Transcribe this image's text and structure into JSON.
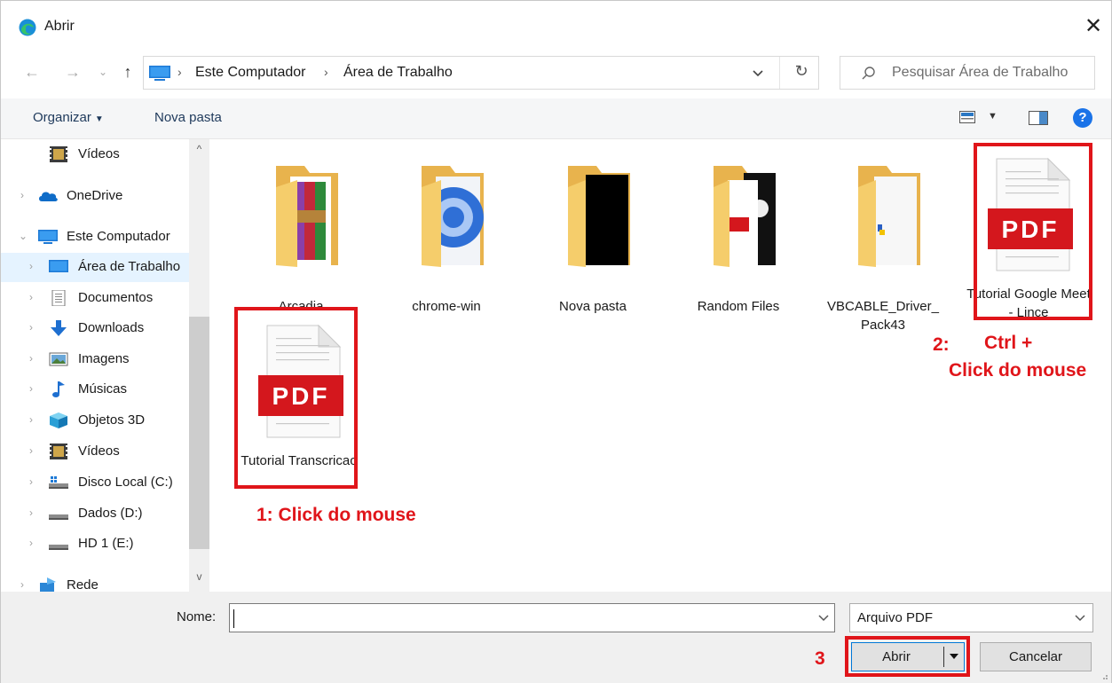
{
  "window": {
    "title": "Abrir",
    "close_glyph": "✕"
  },
  "nav": {
    "back_glyph": "←",
    "forward_glyph": "→",
    "recent_glyph": "⌄",
    "up_glyph": "↑",
    "breadcrumbs": [
      "Este Computador",
      "Área de Trabalho"
    ],
    "crumb_separator": "›",
    "refresh_glyph": "↻"
  },
  "search": {
    "placeholder": "Pesquisar Área de Trabalho"
  },
  "toolbar": {
    "organize_label": "Organizar",
    "organize_caret": "▼",
    "new_folder_label": "Nova pasta",
    "view_caret": "▼",
    "help_glyph": "?"
  },
  "sidebar": {
    "scroll_up": "^",
    "scroll_down": "v",
    "chevron_right": "›",
    "chevron_down": "⌄",
    "items": [
      {
        "label": "Vídeos",
        "icon": "video-icon"
      },
      {
        "label": "OneDrive",
        "icon": "cloud-icon"
      },
      {
        "label": "Este Computador",
        "icon": "computer-icon"
      },
      {
        "label": "Área de Trabalho",
        "icon": "desktop-icon"
      },
      {
        "label": "Documentos",
        "icon": "document-icon"
      },
      {
        "label": "Downloads",
        "icon": "download-arrow-icon"
      },
      {
        "label": "Imagens",
        "icon": "picture-icon"
      },
      {
        "label": "Músicas",
        "icon": "music-note-icon"
      },
      {
        "label": "Objetos 3D",
        "icon": "cube-3d-icon"
      },
      {
        "label": "Vídeos",
        "icon": "video-icon"
      },
      {
        "label": "Disco Local (C:)",
        "icon": "drive-icon"
      },
      {
        "label": "Dados (D:)",
        "icon": "drive-icon"
      },
      {
        "label": "HD 1 (E:)",
        "icon": "drive-icon"
      },
      {
        "label": "Rede",
        "icon": "network-icon"
      }
    ]
  },
  "files": [
    {
      "name": "Arcadia",
      "type": "folder",
      "thumb": "winrar-books-icon"
    },
    {
      "name": "chrome-win",
      "type": "folder",
      "thumb": "chrome-disc-icon"
    },
    {
      "name": "Nova pasta",
      "type": "folder",
      "thumb": "black-document-icon"
    },
    {
      "name": "Random Files",
      "type": "folder",
      "thumb": "pdf-document-icon"
    },
    {
      "name": "VBCABLE_Driver_ Pack43",
      "type": "folder",
      "thumb": "setup-document-icon"
    },
    {
      "name": "Tutorial Google Meet - Lince",
      "type": "pdf",
      "thumb": "pdf-file-icon"
    },
    {
      "name": "Tutorial Transcricao",
      "type": "pdf",
      "thumb": "pdf-file-icon"
    }
  ],
  "pdf_badge": "PDF",
  "annotations": {
    "step1": "1: Click do mouse",
    "step2_num": "2:",
    "step2_line1": "Ctrl +",
    "step2_line2": "Click do mouse",
    "step3": "3"
  },
  "bottom": {
    "name_label": "Nome:",
    "name_value": "",
    "filetype_value": "Arquivo PDF",
    "open_label": "Abrir",
    "cancel_label": "Cancelar"
  },
  "colors": {
    "annotation_red": "#e0151a",
    "folder_yellow": "#f5cd6b",
    "pdf_red": "#d4171d",
    "selection_blue": "#e5f3ff",
    "accent_blue": "#0078d7"
  }
}
